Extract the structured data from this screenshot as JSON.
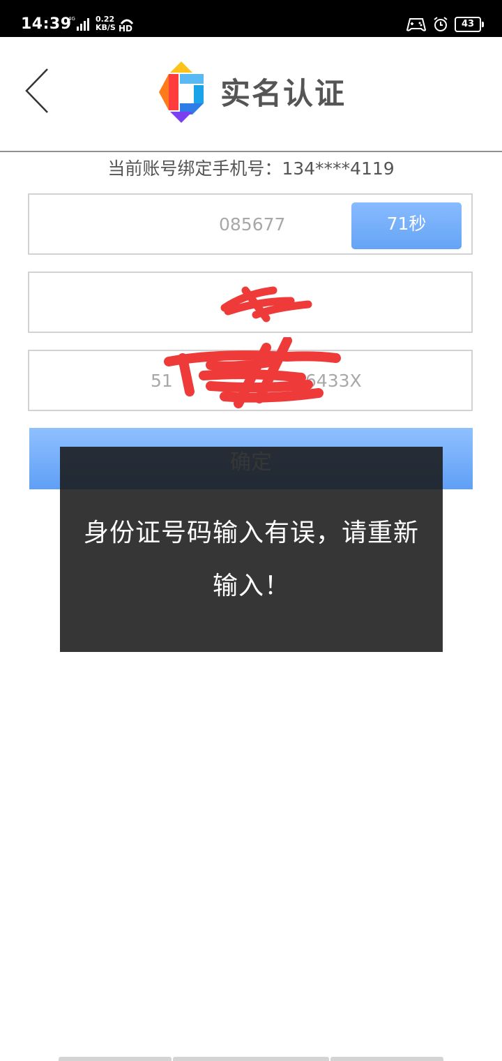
{
  "status_bar": {
    "time": "14:39",
    "network": "0.22",
    "network_unit": "KB/S",
    "hd": "HD",
    "signal": "4G",
    "battery": "43"
  },
  "header": {
    "title": "实名认证"
  },
  "account": {
    "bound_phone": "当前账号绑定手机号：134****4119"
  },
  "form": {
    "verification_code": "085677",
    "countdown_label": "71秒",
    "id_number_visible": "51",
    "id_number_suffix": "06433X",
    "confirm_label": "确定"
  },
  "toast": {
    "message": "身份证号码输入有误，请重新输入！"
  },
  "colors": {
    "accent": "#6aa8f7",
    "toast_bg": "#181818",
    "scribble": "#ef3a3a"
  }
}
